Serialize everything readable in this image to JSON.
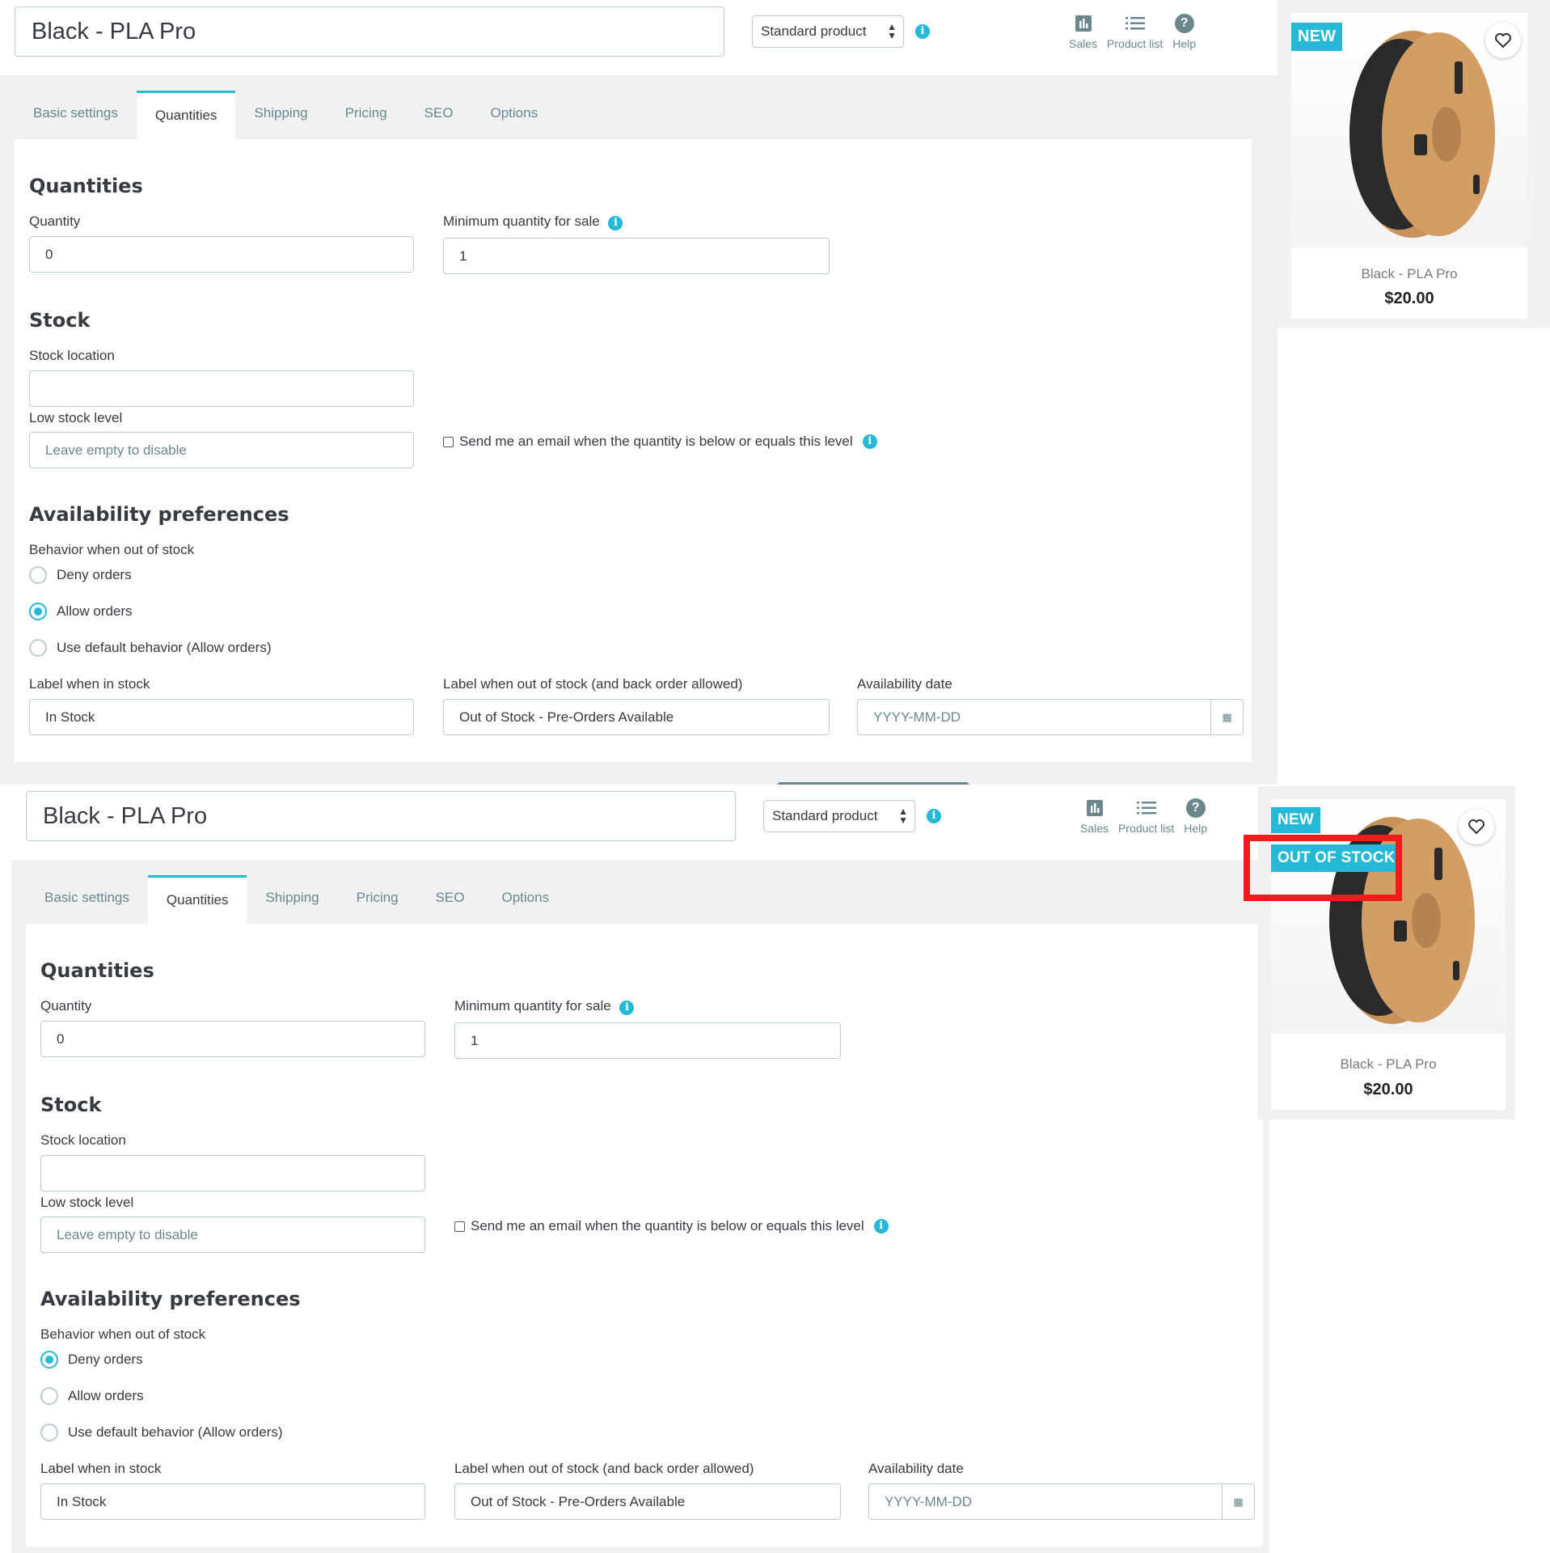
{
  "product": {
    "name": "Black - PLA Pro",
    "type": "Standard product"
  },
  "toolbar": {
    "sales_label": "Sales",
    "product_list_label": "Product list",
    "help_label": "Help"
  },
  "tabs": [
    "Basic settings",
    "Quantities",
    "Shipping",
    "Pricing",
    "SEO",
    "Options"
  ],
  "active_tab": "Quantities",
  "quantities": {
    "title": "Quantities",
    "quantity_label": "Quantity",
    "quantity_value": "0",
    "min_qty_label": "Minimum quantity for sale",
    "min_qty_value": "1"
  },
  "stock": {
    "title": "Stock",
    "location_label": "Stock location",
    "location_value": "",
    "low_stock_label": "Low stock level",
    "low_stock_placeholder": "Leave empty to disable",
    "email_checkbox_label": "Send me an email when the quantity is below or equals this level"
  },
  "availability": {
    "title": "Availability preferences",
    "behavior_label": "Behavior when out of stock",
    "options": [
      "Deny orders",
      "Allow orders",
      "Use default behavior (Allow orders)"
    ],
    "in_stock_label": "Label when in stock",
    "in_stock_value": "In Stock",
    "out_stock_label": "Label when out of stock (and back order allowed)",
    "out_stock_value": "Out of Stock - Pre-Orders Available",
    "date_label": "Availability date",
    "date_placeholder": "YYYY-MM-DD"
  },
  "screens": [
    {
      "selected_behavior": "Allow orders"
    },
    {
      "selected_behavior": "Deny orders"
    }
  ],
  "card": {
    "new_badge": "NEW",
    "out_of_stock_badge": "OUT OF STOCK",
    "name": "Black - PLA Pro",
    "price": "$20.00"
  },
  "colors": {
    "accent": "#25b9d7",
    "highlight": "#ee1c1c",
    "panel_bg": "#eff1f2"
  },
  "icons": [
    "bar-chart-icon",
    "list-icon",
    "help-icon",
    "info-icon",
    "calendar-icon",
    "heart-icon"
  ]
}
